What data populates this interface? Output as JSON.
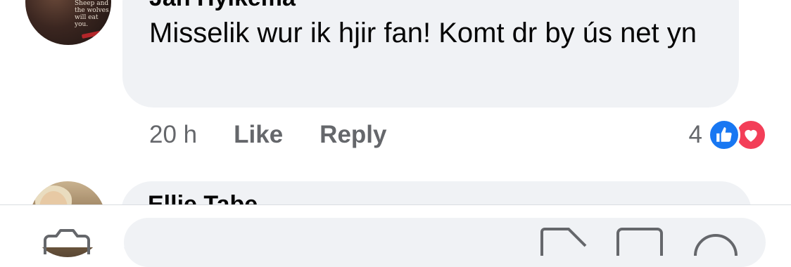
{
  "comments": [
    {
      "author": "Jan Hylkema",
      "text": "Misselik wur ik hjir fan! Komt dr by ús net yn",
      "time": "20 h",
      "like_label": "Like",
      "reply_label": "Reply",
      "reaction_count": "4",
      "reactions": [
        "like-icon",
        "love-icon"
      ],
      "avatar_quote": "Sheep and the wolves will eat you."
    },
    {
      "author": "Ellie Tabe..."
    }
  ],
  "composer": {
    "placeholder": ""
  },
  "colors": {
    "bubble": "#f0f2f5",
    "meta_text": "#65676b",
    "like_blue": "#1877f2",
    "love_red": "#f33e58"
  }
}
